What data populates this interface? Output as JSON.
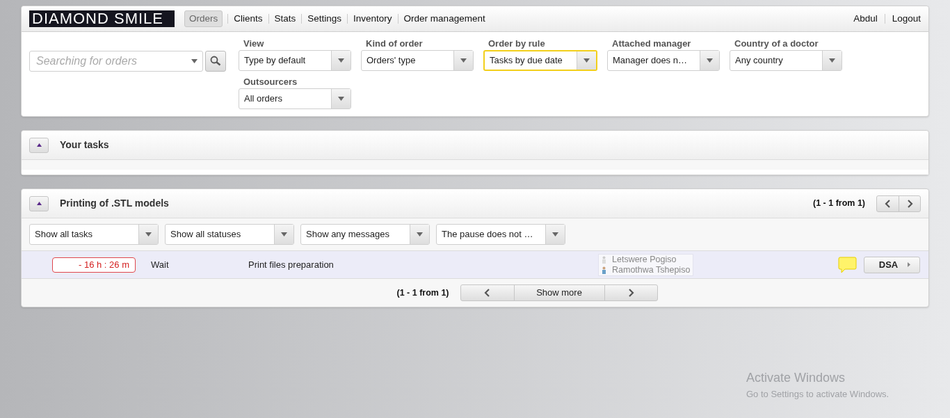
{
  "logo": "DIAMOND SMILE",
  "nav": [
    {
      "label": "Orders",
      "selected": true
    },
    {
      "label": "Clients",
      "selected": false
    },
    {
      "label": "Stats",
      "selected": false
    },
    {
      "label": "Settings",
      "selected": false
    },
    {
      "label": "Inventory",
      "selected": false
    },
    {
      "label": "Order management",
      "selected": false
    }
  ],
  "user_links": [
    "Abdul",
    "Logout"
  ],
  "search": {
    "placeholder": "Searching for orders"
  },
  "filters": [
    {
      "label": "View",
      "value": "Type by default",
      "focused": false
    },
    {
      "label": "Kind of order",
      "value": "Orders' type",
      "focused": false
    },
    {
      "label": "Order by rule",
      "value": "Tasks by due date",
      "focused": true
    },
    {
      "label": "Attached manager",
      "value": "Manager does n…",
      "focused": false
    },
    {
      "label": "Country of a doctor",
      "value": "Any country",
      "focused": false
    },
    {
      "label": "Outsourcers",
      "value": "All orders",
      "focused": false
    }
  ],
  "sections": [
    {
      "title": "Your tasks",
      "expanded": true
    },
    {
      "title": "Printing of .STL models",
      "expanded": true,
      "range": "(1 - 1 from 1)",
      "filters": [
        "Show all tasks",
        "Show all statuses",
        "Show any messages",
        "The pause does not …"
      ],
      "rows": [
        {
          "timer": "- 16 h : 26 m",
          "overdue": true,
          "status": "Wait",
          "task": "Print files preparation",
          "people": [
            "Letswere Pogiso",
            "Ramothwa Tshepiso"
          ],
          "has_message": true,
          "action": "DSA"
        }
      ],
      "footer_range": "(1 - 1 from 1)",
      "show_more": "Show more"
    }
  ],
  "os_notice": {
    "title": "Activate Windows",
    "text": "Go to Settings to activate Windows."
  }
}
